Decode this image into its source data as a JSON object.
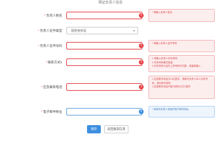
{
  "title": "网证负责人信息",
  "fields": [
    {
      "label": "负责人姓名",
      "value": "",
      "tip": [
        "* 请输入负责人姓名"
      ]
    },
    {
      "label": "负责人证件类型",
      "selected": "居民身份证"
    },
    {
      "label": "负责人证件号码",
      "value": "",
      "tip": [
        "* 请输入负责人证件号码"
      ]
    },
    {
      "label": "联系方式1",
      "value": "",
      "tip": [
        "1.请输入负责人手机号码",
        "2.手机号码格式错误",
        "3.手机号码与证件上的号码不匹配，请重新输入"
      ]
    },
    {
      "label": "应急联系电话",
      "value": "",
      "tip": [
        "1.应急联系电话为11位数字，请填写负责人本人手机号码，请勿填写座机",
        "2.应急联系电话不能与联系方式1相同"
      ]
    },
    {
      "label": "电子邮件地址",
      "value": "",
      "tip": [
        "* 请填写负责人常用的电子邮件地址"
      ]
    }
  ],
  "status_icons": {
    "error": "!",
    "info": "i"
  },
  "buttons": {
    "save": "保存",
    "back": "返回备案信息"
  },
  "colors": {
    "error": "#e5484d",
    "info": "#3d8fe0",
    "primary": "#3d8fe0"
  }
}
